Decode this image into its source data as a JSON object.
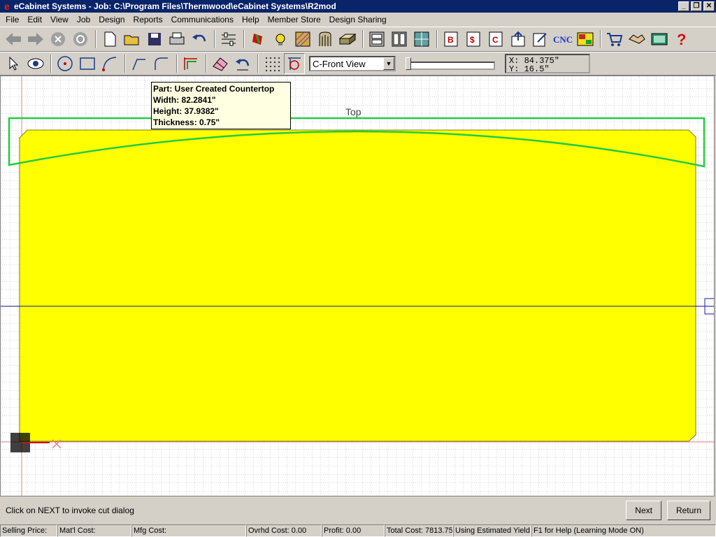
{
  "window": {
    "title": "eCabinet Systems - Job: C:\\Program Files\\Thermwood\\eCabinet Systems\\R2mod"
  },
  "menu": [
    "File",
    "Edit",
    "View",
    "Job",
    "Design",
    "Reports",
    "Communications",
    "Help",
    "Member Store",
    "Design Sharing"
  ],
  "toolbar2": {
    "view_selected": "C-Front View"
  },
  "coordinates": {
    "x": "X: 84.375\"",
    "y": "Y: 16.5\""
  },
  "tooltip": {
    "part": "Part: User Created Countertop",
    "width": "Width: 82.2841\"",
    "height": "Height: 37.9382\"",
    "thickness": "Thickness: 0.75\""
  },
  "canvas": {
    "top_label": "Top",
    "colors": {
      "part_fill": "#ffff00",
      "outline": "#22cc44"
    }
  },
  "hint": "Click on NEXT to invoke cut dialog",
  "buttons": {
    "next": "Next",
    "return": "Return"
  },
  "status": {
    "selling_price": "Selling Price:",
    "matl_cost": "Mat'l Cost:",
    "mfg_cost": "Mfg Cost:",
    "ovrhd_cost": "Ovrhd Cost: 0.00",
    "profit": "Profit: 0.00",
    "total_cost": "Total Cost: 7813.75",
    "yield": "Using Estimated Yield",
    "help": "F1 for Help (Learning Mode ON)"
  }
}
